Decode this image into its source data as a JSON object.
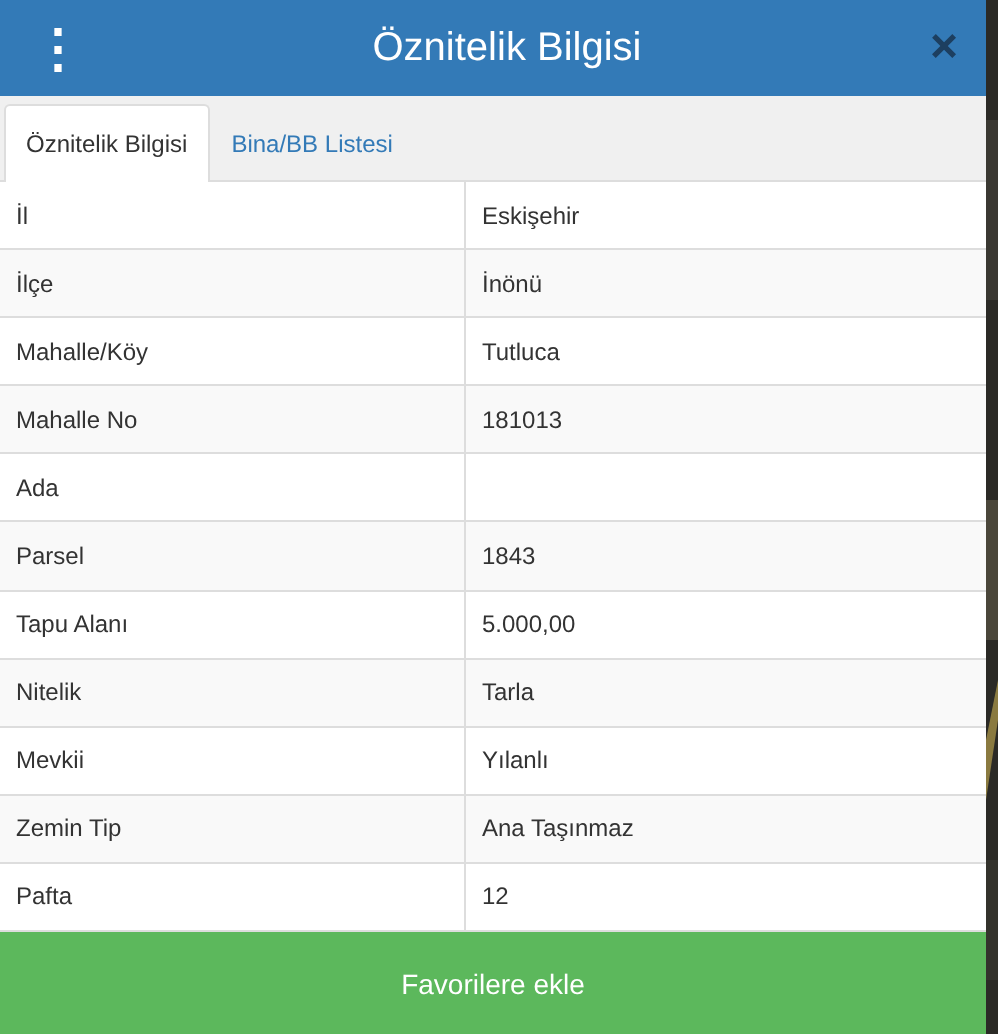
{
  "header": {
    "menu_icon": "⋮",
    "title": "Öznitelik Bilgisi",
    "close_icon": "×"
  },
  "tabs": [
    {
      "label": "Öznitelik Bilgisi",
      "selected": true
    },
    {
      "label": "Bina/BB Listesi",
      "selected": false
    }
  ],
  "table": {
    "rows": [
      {
        "label": "İl",
        "value": "Eskişehir"
      },
      {
        "label": "İlçe",
        "value": "İnönü"
      },
      {
        "label": "Mahalle/Köy",
        "value": "Tutluca"
      },
      {
        "label": "Mahalle No",
        "value": "181013"
      },
      {
        "label": "Ada"
      },
      {
        "label": "Parsel",
        "value": "1843"
      },
      {
        "label": "Tapu Alanı",
        "value": "5.000,00"
      },
      {
        "label": "Nitelik",
        "value": "Tarla"
      },
      {
        "label": "Mevkii",
        "value": "Yılanlı"
      },
      {
        "label": "Zemin Tip",
        "value": "Ana Taşınmaz"
      },
      {
        "label": "Pafta",
        "value": "12"
      }
    ]
  },
  "button": "Favorilere ekle"
}
